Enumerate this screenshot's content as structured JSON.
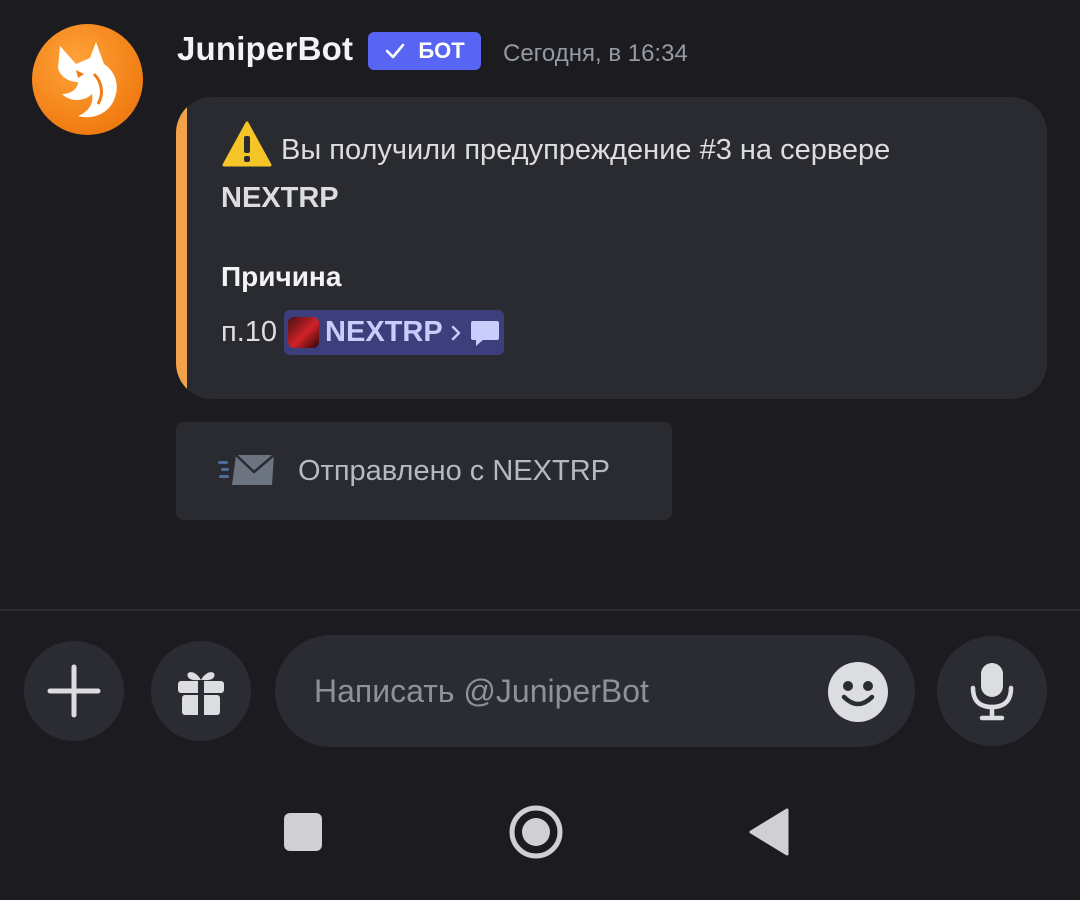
{
  "message": {
    "author": "JuniperBot",
    "bot_tag": "БОТ",
    "timestamp": "Сегодня, в 16:34",
    "avatar_icon": "fox-avatar-icon"
  },
  "embed": {
    "accent_color": "#f3a14b",
    "title_line1": "Вы получили предупреждение #3 на сервере",
    "title_line2": "NEXTRP",
    "field_name": "Причина",
    "field_value_prefix": "п.10",
    "channel_mention": {
      "label": "NEXTRP",
      "icons": [
        "server-thumbnail-icon",
        "chevron-right-icon",
        "chat-bubble-icon"
      ]
    }
  },
  "sent_from": {
    "label": "Отправлено с NEXTRP",
    "icon": "envelope-icon"
  },
  "composer": {
    "placeholder": "Написать @JuniperBot",
    "buttons": [
      "plus-icon",
      "gift-icon",
      "emoji-icon",
      "microphone-icon"
    ]
  },
  "system_nav": [
    "recents-icon",
    "home-icon",
    "back-icon"
  ],
  "colors": {
    "background": "#1b1b20",
    "surface": "#2a2a31",
    "bot_tag": "#5865f2",
    "mention_bg": "#3d3f7c"
  }
}
